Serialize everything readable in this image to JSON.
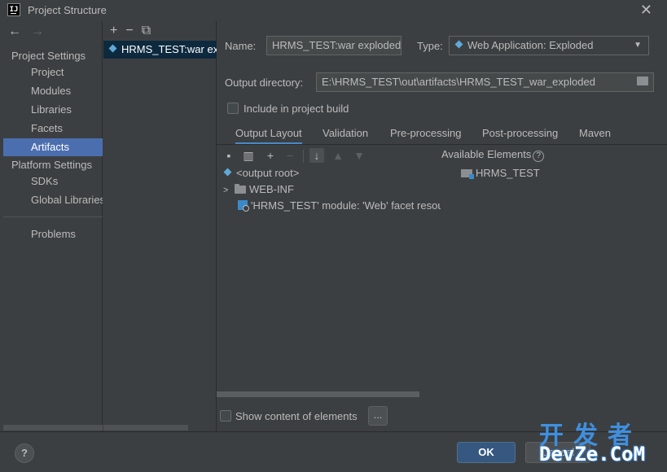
{
  "window": {
    "title": "Project Structure",
    "app_icon_text": "IJ"
  },
  "nav": {
    "back": "←",
    "forward": "→",
    "project_settings_header": "Project Settings",
    "project_items": [
      "Project",
      "Modules",
      "Libraries",
      "Facets",
      "Artifacts"
    ],
    "selected": "Artifacts",
    "platform_settings_header": "Platform Settings",
    "platform_items": [
      "SDKs",
      "Global Libraries"
    ],
    "problems": "Problems"
  },
  "artifacts": {
    "toolbar": {
      "add": "+",
      "remove": "−",
      "copy": "⧉"
    },
    "items": [
      "HRMS_TEST:war exploded"
    ]
  },
  "form": {
    "name_label": "Name:",
    "name_value": "HRMS_TEST:war exploded",
    "type_label": "Type:",
    "type_value": "Web Application: Exploded",
    "output_dir_label": "Output directory:",
    "output_dir_value": "E:\\HRMS_TEST\\out\\artifacts\\HRMS_TEST_war_exploded",
    "include_build_label": "Include in project build",
    "include_build_checked": false
  },
  "tabs": [
    "Output Layout",
    "Validation",
    "Pre-processing",
    "Post-processing",
    "Maven"
  ],
  "active_tab": "Output Layout",
  "tree": {
    "root": "<output root>",
    "web_inf": "WEB-INF",
    "facet_resources": "'HRMS_TEST' module: 'Web' facet resou"
  },
  "available": {
    "title": "Available Elements",
    "help": "?",
    "items": [
      "HRMS_TEST"
    ]
  },
  "show_content_label": "Show content of elements",
  "ellipsis": "...",
  "buttons": {
    "help": "?",
    "ok": "OK",
    "cancel": "Cancel"
  },
  "watermark": {
    "cn": "开发者",
    "en": "DevZe.CoM"
  },
  "colors": {
    "selection": "#4b6eaf",
    "accent_tab": "#4a88c7",
    "ok_button": "#365880",
    "background": "#3c3f41"
  }
}
